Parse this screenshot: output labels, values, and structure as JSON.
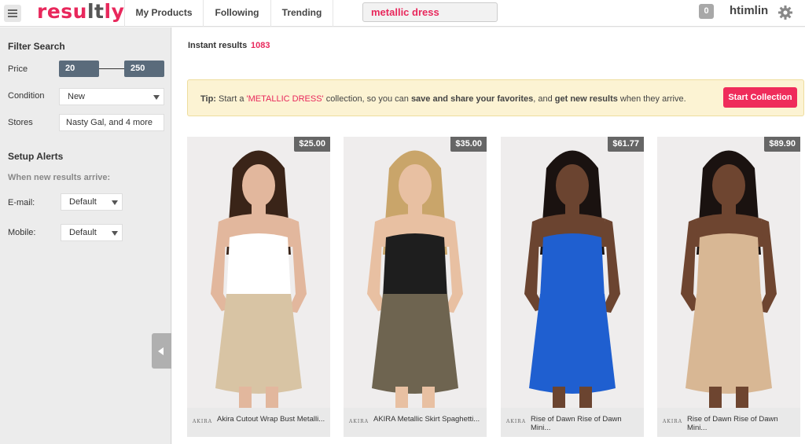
{
  "header": {
    "logo_text": "resultly",
    "nav": [
      "My Products",
      "Following",
      "Trending"
    ],
    "search_value": "metallic dress",
    "notification_count": "0",
    "username": "htimlin"
  },
  "sidebar": {
    "filter_title": "Filter Search",
    "price_label": "Price",
    "price_min": "20",
    "price_max": "250",
    "condition_label": "Condition",
    "condition_value": "New",
    "stores_label": "Stores",
    "stores_value": "Nasty Gal, and 4 more",
    "alerts_title": "Setup Alerts",
    "alerts_subtitle": "When new results arrive:",
    "email_label": "E-mail:",
    "email_value": "Default",
    "mobile_label": "Mobile:",
    "mobile_value": "Default"
  },
  "main": {
    "results_label": "Instant results",
    "results_count": "1083",
    "tip": {
      "prefix": "Tip:",
      "part1": "Start a ",
      "highlight": "'METALLIC DRESS'",
      "part2": " collection, so you can ",
      "bold1": "save and share your favorites",
      "part3": ", and ",
      "bold2": "get new results",
      "part4": " when they arrive.",
      "button": "Start Collection"
    },
    "products": [
      {
        "price": "$25.00",
        "brand": "AKIRA",
        "title": "Akira Cutout Wrap Bust Metalli...",
        "skin": "#e2b79d",
        "hair": "#3a2418",
        "top": "#ffffff",
        "skirt": "#d8c4a4"
      },
      {
        "price": "$35.00",
        "brand": "AKIRA",
        "title": "AKIRA Metallic Skirt Spaghetti...",
        "skin": "#e8c0a2",
        "hair": "#c9a56a",
        "top": "#1e1e1e",
        "skirt": "#6e6450"
      },
      {
        "price": "$61.77",
        "brand": "AKIRA",
        "title": "Rise of Dawn Rise of Dawn Mini...",
        "skin": "#6b4430",
        "hair": "#1a1210",
        "top": "#1f5fd0",
        "skirt": "#1f5fd0"
      },
      {
        "price": "$89.90",
        "brand": "AKIRA",
        "title": "Rise of Dawn Rise of Dawn Mini...",
        "skin": "#6e4530",
        "hair": "#1a1210",
        "top": "#d8b794",
        "skirt": "#d8b794"
      }
    ]
  }
}
